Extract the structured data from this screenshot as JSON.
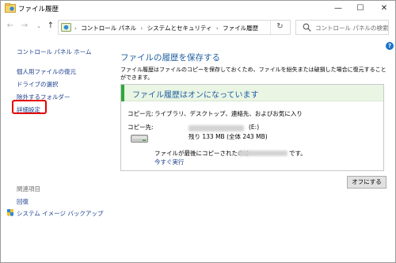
{
  "window": {
    "title": "ファイル履歴",
    "minimize": "—",
    "maximize": "☐",
    "close": "✕"
  },
  "nav": {
    "back": "←",
    "forward": "→",
    "recent": "⌄",
    "up": "↑",
    "breadcrumbs": [
      "コントロール パネル",
      "システムとセキュリティ",
      "ファイル履歴"
    ],
    "separator": "›",
    "dropdown": "⌄",
    "refresh": "↻",
    "search_placeholder": "コントロール パネルの検索"
  },
  "help": "?",
  "sidebar": {
    "home": "コントロール パネル ホーム",
    "items": [
      "個人用ファイルの復元",
      "ドライブの選択",
      "除外するフォルダー",
      "詳細設定"
    ],
    "related_heading": "関連項目",
    "related": [
      "回復",
      "システム イメージ バックアップ"
    ]
  },
  "main": {
    "title": "ファイルの履歴を保存する",
    "description": "ファイル履歴はファイルのコピーを保存しておくため、ファイルを紛失または破損した場合に復元することができます。",
    "status": "ファイル履歴はオンになっています",
    "copy_from_label": "コピー元:",
    "copy_from_value": "ライブラリ、デスクトップ、連絡先、およびお気に入り",
    "copy_to_label": "コピー先:",
    "drive_letter": "(E:)",
    "drive_size": "残り 133 MB (全体 243 MB)",
    "last_copy_prefix": "ファイルが最後にコピーされたのは",
    "last_copy_suffix": "です。",
    "run_now": "今すぐ実行",
    "turn_off_button": "オフにする"
  },
  "colors": {
    "accent_blue": "#1f5fa0",
    "link_blue": "#1a3e8c",
    "status_green": "#2ea83a",
    "highlight_red": "#e60000"
  }
}
